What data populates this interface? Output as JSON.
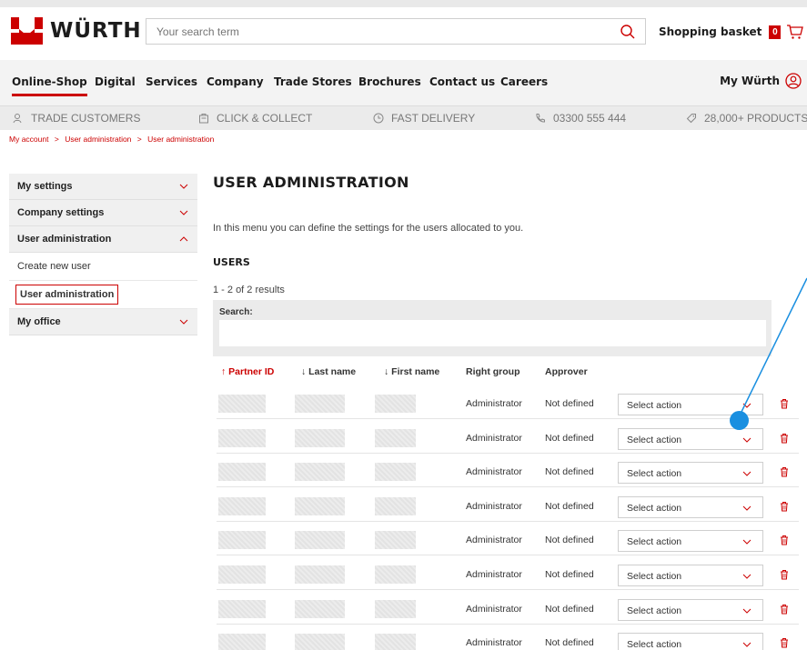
{
  "header": {
    "logo_text": "WÜRTH",
    "search_placeholder": "Your search term",
    "basket_label": "Shopping basket",
    "basket_count": "0"
  },
  "nav": {
    "items": [
      "Online-Shop",
      "Digital",
      "Services",
      "Company",
      "Trade Stores",
      "Brochures",
      "Contact us",
      "Careers"
    ],
    "my_account": "My Würth"
  },
  "usp": {
    "trade": "TRADE CUSTOMERS",
    "collect": "CLICK & COLLECT",
    "delivery": "FAST DELIVERY",
    "phone": "03300 555 444",
    "products": "28,000+ PRODUCTS"
  },
  "breadcrumb": [
    "My account",
    ">",
    "User administration",
    ">",
    "User administration"
  ],
  "sidebar": {
    "my_settings": "My settings",
    "company_settings": "Company settings",
    "user_admin": "User administration",
    "create_user": "Create new user",
    "user_admin_sub": "User administration",
    "my_office": "My office"
  },
  "main": {
    "title": "USER ADMINISTRATION",
    "intro": "In this menu you can define the settings for the users allocated to you.",
    "section": "USERS",
    "results": "1 - 2 of 2 results",
    "search_label": "Search:"
  },
  "table": {
    "headers": {
      "partner_id": "↑ Partner ID",
      "last_name": "↓ Last name",
      "first_name": "↓ First name",
      "right_group": "Right group",
      "approver": "Approver"
    },
    "rows": [
      {
        "right_group": "Administrator",
        "approver": "Not defined",
        "action": "Select action"
      },
      {
        "right_group": "Administrator",
        "approver": "Not defined",
        "action": "Select action"
      },
      {
        "right_group": "Administrator",
        "approver": "Not defined",
        "action": "Select action"
      },
      {
        "right_group": "Administrator",
        "approver": "Not defined",
        "action": "Select action"
      },
      {
        "right_group": "Administrator",
        "approver": "Not defined",
        "action": "Select action"
      },
      {
        "right_group": "Administrator",
        "approver": "Not defined",
        "action": "Select action"
      },
      {
        "right_group": "Administrator",
        "approver": "Not defined",
        "action": "Select action"
      },
      {
        "right_group": "Administrator",
        "approver": "Not defined",
        "action": "Select action"
      }
    ]
  },
  "colors": {
    "brand_red": "#cc0000",
    "annotation_blue": "#1a8fe0"
  }
}
